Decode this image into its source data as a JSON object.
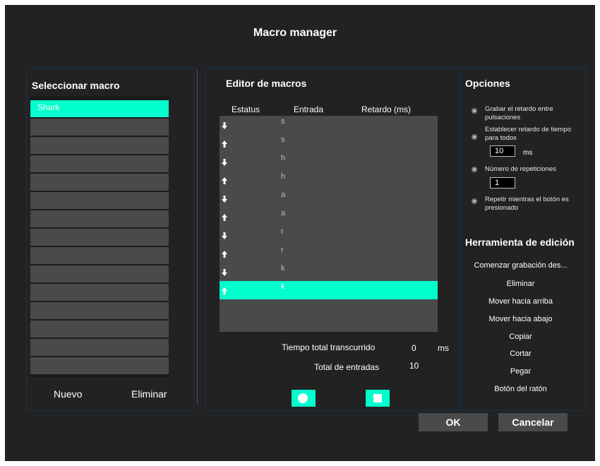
{
  "title": "Macro manager",
  "select_panel": {
    "title": "Seleccionar macro",
    "macros": [
      "Shark",
      "",
      "",
      "",
      "",
      "",
      "",
      "",
      "",
      "",
      "",
      "",
      "",
      "",
      ""
    ],
    "new_label": "Nuevo",
    "delete_label": "Eliminar"
  },
  "editor": {
    "title": "Editor de macros",
    "columns": [
      "Estatus",
      "Entrada",
      "Retardo (ms)"
    ],
    "entries": [
      {
        "status": "down",
        "key": "s"
      },
      {
        "status": "up",
        "key": "s"
      },
      {
        "status": "down",
        "key": "h"
      },
      {
        "status": "up",
        "key": "h"
      },
      {
        "status": "down",
        "key": "a"
      },
      {
        "status": "up",
        "key": "a"
      },
      {
        "status": "down",
        "key": "r"
      },
      {
        "status": "up",
        "key": "r"
      },
      {
        "status": "down",
        "key": "k"
      },
      {
        "status": "up",
        "key": "k",
        "selected": true
      }
    ],
    "elapsed_label": "Tiempo total transcurrido",
    "elapsed_value": "0",
    "elapsed_unit": "ms",
    "entries_label": "Total de entradas",
    "entries_value": "10",
    "record_icon": "record-circle-icon",
    "stop_icon": "stop-square-icon"
  },
  "options": {
    "title": "Opciones",
    "record_delay": "Grabar el retardo entre pulsaciones",
    "set_delay": "Establecer retardo de tiempo para todos",
    "delay_value": "10",
    "delay_unit": "ms",
    "repeat_count_label": "Número de repeticiones",
    "repeat_count_value": "1",
    "repeat_while_pressed": "Repetir mientras el botón es presionado"
  },
  "tools": {
    "title": "Herramienta de edición",
    "items": [
      "Comenzar grabación des...",
      "Eliminar",
      "Mover hacia arriba",
      "Mover hacia abajo",
      "Copiar",
      "Cortar",
      "Pegar",
      "Botón del ratón"
    ]
  },
  "buttons": {
    "ok": "OK",
    "cancel": "Cancelar"
  },
  "colors": {
    "accent": "#00ffcc",
    "background": "#222222",
    "panel_border": "#17324f",
    "item": "#4a4a4a"
  }
}
